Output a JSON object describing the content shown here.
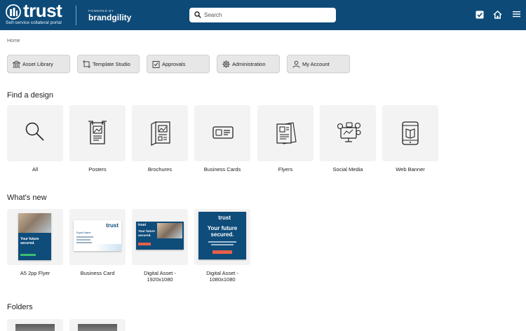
{
  "header": {
    "logo_text": "trust",
    "tagline": "Self-service collateral portal",
    "powered_by": "POWERED BY",
    "brand": "brandgility",
    "search_placeholder": "Search",
    "bg_color": "#0d4a78"
  },
  "breadcrumb": "Home",
  "nav": [
    {
      "label": "Asset Library",
      "icon": "bank-icon"
    },
    {
      "label": "Template Studio",
      "icon": "frame-icon"
    },
    {
      "label": "Approvals",
      "icon": "checkbox-icon"
    },
    {
      "label": "Administration",
      "icon": "gear-icon"
    },
    {
      "label": "My Account",
      "icon": "user-icon"
    }
  ],
  "find_design": {
    "title": "Find a design",
    "items": [
      {
        "label": "All",
        "icon": "magnifier-icon"
      },
      {
        "label": "Posters",
        "icon": "poster-icon"
      },
      {
        "label": "Brochures",
        "icon": "brochure-icon"
      },
      {
        "label": "Business Cards",
        "icon": "business-card-icon"
      },
      {
        "label": "Flyers",
        "icon": "flyer-icon"
      },
      {
        "label": "Social Media",
        "icon": "social-media-icon"
      },
      {
        "label": "Web Banner",
        "icon": "tablet-icon"
      }
    ]
  },
  "whats_new": {
    "title": "What's new",
    "items": [
      {
        "label": "A5 2pp Flyer",
        "headline_1": "Your future",
        "headline_2": "secured."
      },
      {
        "label": "Business Card",
        "brand": "trust",
        "person": "Expert Name"
      },
      {
        "label": "Digital Asset -\n1920x1080",
        "brand": "trust",
        "headline_1": "Your future",
        "headline_2": "secured."
      },
      {
        "label": "Digital Asset -\n1080x1080",
        "brand": "trust",
        "headline_1": "Your future",
        "headline_2": "secured."
      }
    ]
  },
  "folders": {
    "title": "Folders"
  }
}
